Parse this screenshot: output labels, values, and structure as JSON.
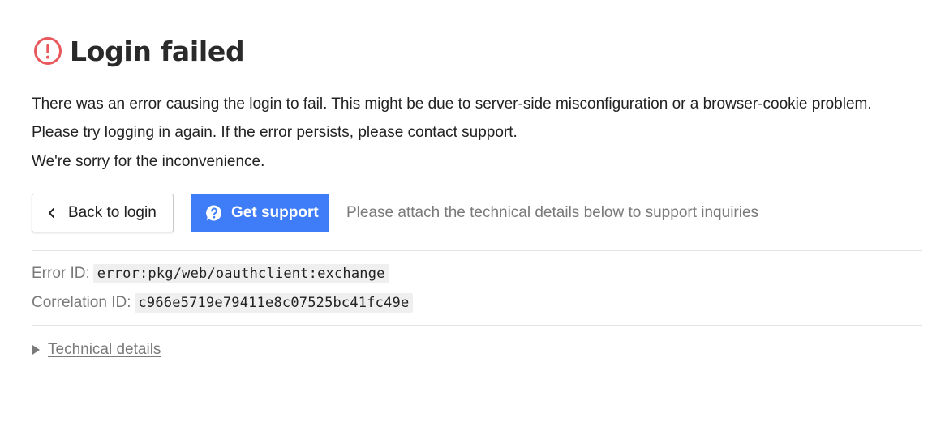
{
  "header": {
    "icon": "exclamation-circle-icon",
    "title": "Login failed",
    "icon_color": "#e8585c"
  },
  "message": {
    "line1": "There was an error causing the login to fail. This might be due to server-side misconfiguration or a browser-cookie problem.",
    "line2": "Please try logging in again. If the error persists, please contact support.",
    "line3": "We're sorry for the inconvenience."
  },
  "actions": {
    "back_label": "Back to login",
    "back_icon": "chevron-left-icon",
    "support_label": "Get support",
    "support_icon": "question-bubble-icon",
    "support_color": "#3f7cf7",
    "hint": "Please attach the technical details below to support inquiries"
  },
  "details": {
    "error_id_label": "Error ID:",
    "error_id": "error:pkg/web/oauthclient:exchange",
    "correlation_id_label": "Correlation ID:",
    "correlation_id": "c966e5719e79411e8c07525bc41fc49e"
  },
  "technical": {
    "label": "Technical details",
    "icon": "triangle-right-icon"
  }
}
